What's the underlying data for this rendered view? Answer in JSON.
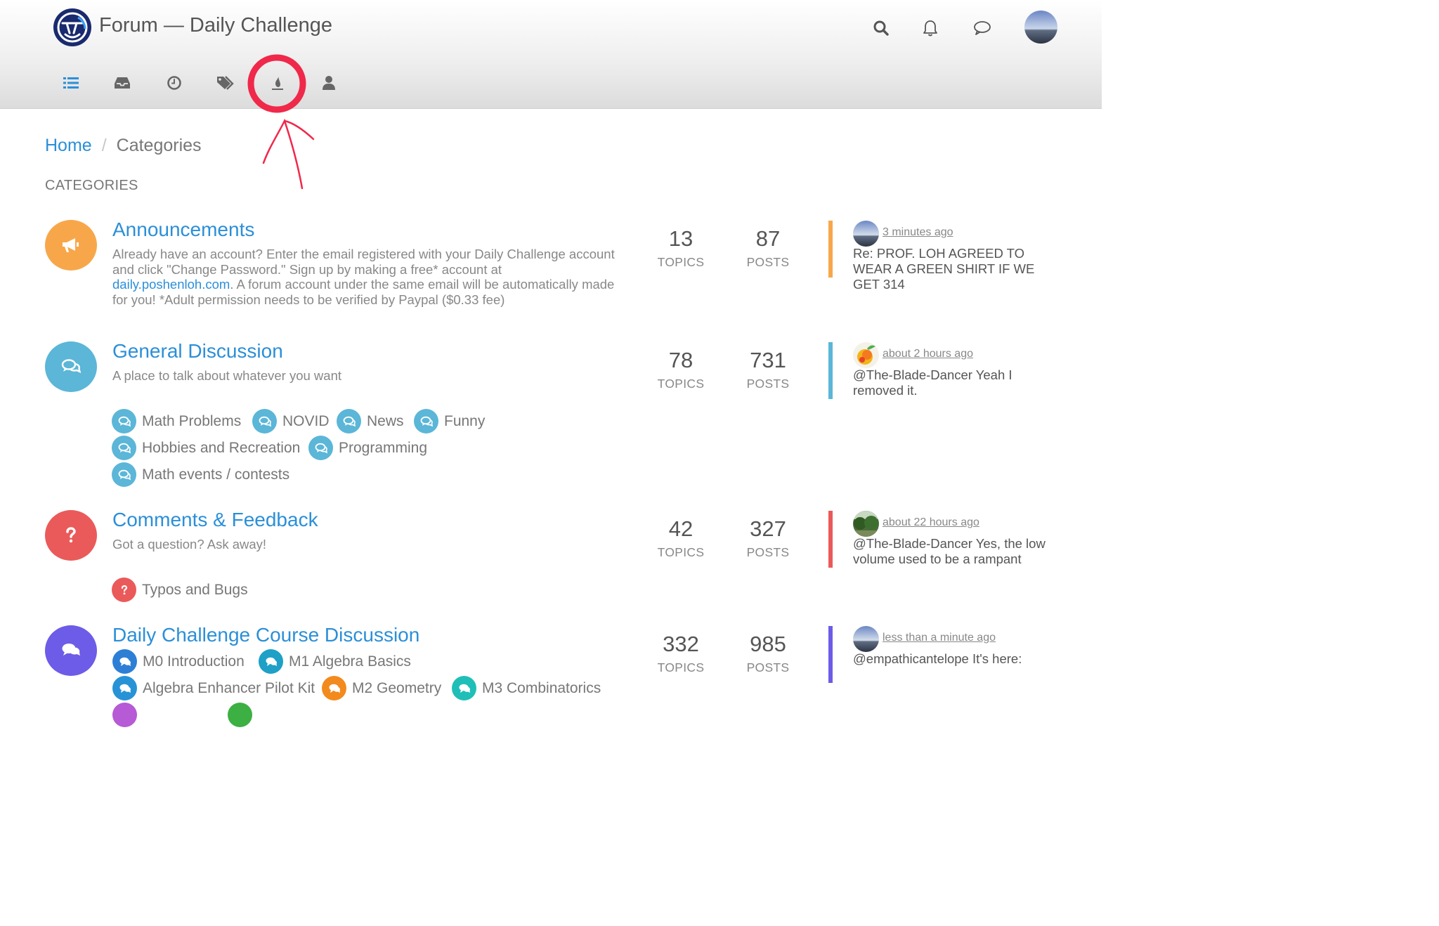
{
  "header": {
    "site_title": "Forum — Daily Challenge"
  },
  "colors": {
    "accent": "#2b8fd8",
    "announcements": "#f7a74a",
    "general": "#5bb6d8",
    "feedback": "#ea5a5a",
    "course": "#6c5ce7",
    "annotation": "#f0284a"
  },
  "breadcrumb": {
    "home": "Home",
    "separator": "/",
    "current": "Categories"
  },
  "section_heading": "CATEGORIES",
  "stat_labels": {
    "topics": "TOPICS",
    "posts": "POSTS"
  },
  "categories": [
    {
      "title": "Announcements",
      "desc_before": "Already have an account? Enter the email registered with your Daily Challenge account and click \"Change Password.\" Sign up by making a free* account at ",
      "desc_link": "daily.poshenloh.com",
      "desc_after": ". A forum account under the same email will be automatically made for you! *Adult permission needs to be verified by Paypal ($0.33 fee)",
      "icon": "bullhorn-icon",
      "topics": "13",
      "posts": "87",
      "teaser_time": "3 minutes ago",
      "teaser_text": "Re: PROF. LOH AGREED TO WEAR A GREEN SHIRT IF WE GET 314"
    },
    {
      "title": "General Discussion",
      "desc": "A place to talk about whatever you want",
      "icon": "comments-icon",
      "topics": "78",
      "posts": "731",
      "teaser_time": "about 2 hours ago",
      "teaser_text": "@The-Blade-Dancer Yeah I removed it.",
      "subcategories": [
        "Math Problems",
        "NOVID",
        "News",
        "Funny",
        "Hobbies and Recreation",
        "Programming",
        "Math events / contests"
      ]
    },
    {
      "title": "Comments & Feedback",
      "desc": "Got a question? Ask away!",
      "icon": "question-icon",
      "topics": "42",
      "posts": "327",
      "teaser_time": "about 22 hours ago",
      "teaser_text": "@The-Blade-Dancer Yes, the low volume used to be a rampant",
      "subcategories": [
        "Typos and Bugs"
      ]
    },
    {
      "title": "Daily Challenge Course Discussion",
      "icon": "comments-icon",
      "topics": "332",
      "posts": "985",
      "teaser_time": "less than a minute ago",
      "teaser_text": "@empathicantelope It's here:",
      "subcategories": [
        "M0 Introduction",
        "M1 Algebra Basics",
        "Algebra Enhancer Pilot Kit",
        "M2 Geometry",
        "M3 Combinatorics"
      ]
    }
  ]
}
